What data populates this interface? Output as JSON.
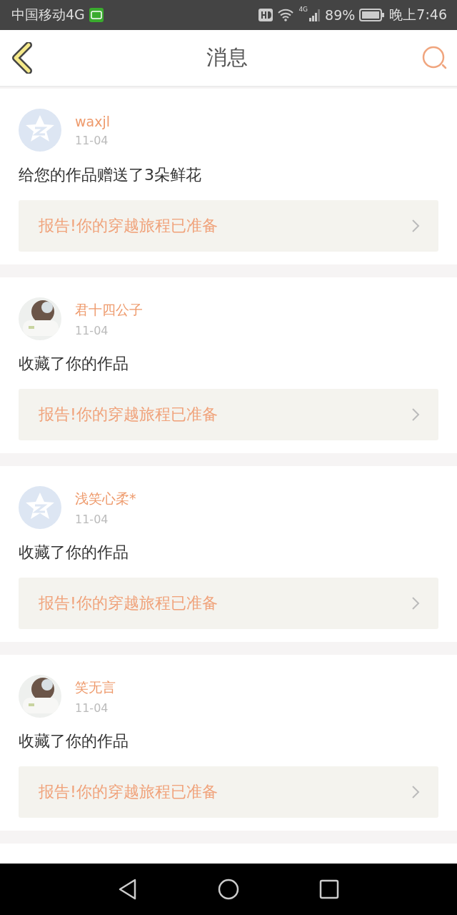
{
  "status_bar": {
    "carrier": "中国移动4G",
    "network": "4G",
    "battery": "89%",
    "time": "晚上7:46"
  },
  "header": {
    "title": "消息"
  },
  "messages": [
    {
      "avatar": {
        "kind": "default"
      },
      "name": "waxjl",
      "date": "11-04",
      "text": "给您的作品赠送了3朵鲜花",
      "link": "报告!你的穿越旅程已准备"
    },
    {
      "name": "君十四公子",
      "date": "11-04",
      "text": "收藏了你的作品",
      "link": "报告!你的穿越旅程已准备"
    },
    {
      "avatar": {
        "kind": "default"
      },
      "name": "浅笑心柔*",
      "date": "11-04",
      "text": "收藏了你的作品",
      "link": "报告!你的穿越旅程已准备"
    },
    {
      "name": "笑无言",
      "date": "11-04",
      "text": "收藏了你的作品",
      "link": "报告!你的穿越旅程已准备"
    }
  ]
}
